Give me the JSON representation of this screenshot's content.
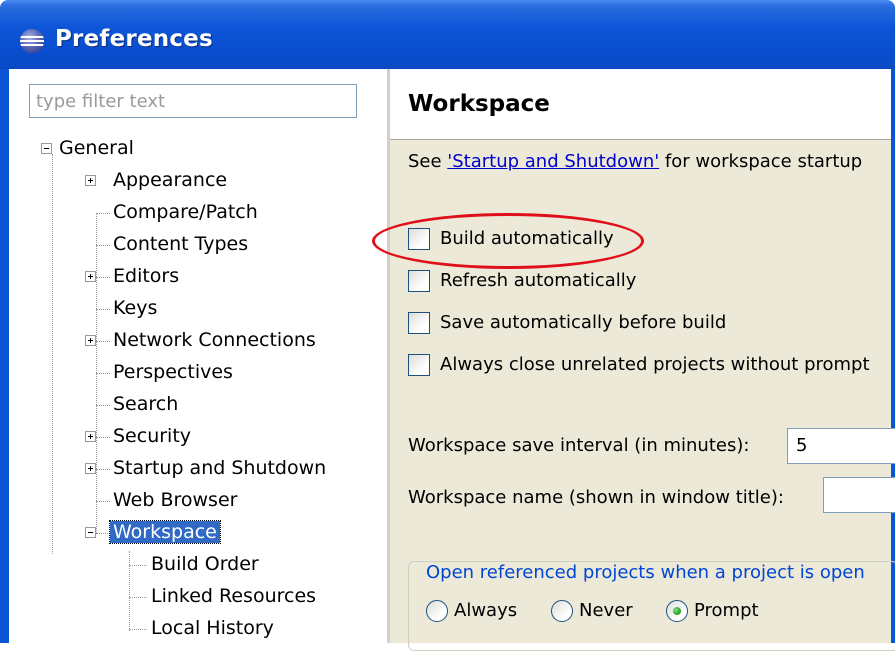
{
  "window": {
    "title": "Preferences",
    "icon": "eclipse-icon"
  },
  "filter": {
    "placeholder": "type filter text",
    "value": ""
  },
  "tree": {
    "items": [
      {
        "label": "General",
        "expanded": true
      },
      {
        "label": "Appearance",
        "expanded": false
      },
      {
        "label": "Compare/Patch"
      },
      {
        "label": "Content Types"
      },
      {
        "label": "Editors",
        "expanded": false
      },
      {
        "label": "Keys"
      },
      {
        "label": "Network Connections",
        "expanded": false
      },
      {
        "label": "Perspectives"
      },
      {
        "label": "Search"
      },
      {
        "label": "Security",
        "expanded": false
      },
      {
        "label": "Startup and Shutdown",
        "expanded": false
      },
      {
        "label": "Web Browser"
      },
      {
        "label": "Workspace",
        "expanded": true,
        "selected": true
      },
      {
        "label": "Build Order"
      },
      {
        "label": "Linked Resources"
      },
      {
        "label": "Local History"
      }
    ]
  },
  "page": {
    "title": "Workspace",
    "see_prefix": "See ",
    "see_link": "'Startup and Shutdown'",
    "see_suffix": " for workspace startup",
    "checkboxes": [
      {
        "label": "Build automatically",
        "checked": false,
        "highlighted": true
      },
      {
        "label": "Refresh automatically",
        "checked": false
      },
      {
        "label": "Save automatically before build",
        "checked": false
      },
      {
        "label": "Always close unrelated projects without prompt",
        "checked": false
      }
    ],
    "save_interval_label": "Workspace save interval (in minutes):",
    "save_interval_value": "5",
    "workspace_name_label": "Workspace name (shown in window title):",
    "workspace_name_value": "",
    "group_title": "Open referenced projects when a project is open",
    "radios": [
      {
        "label": "Always",
        "selected": false
      },
      {
        "label": "Never",
        "selected": false
      },
      {
        "label": "Prompt",
        "selected": true
      }
    ]
  },
  "colors": {
    "titlebar": "#0b54d6",
    "selection": "#316ac5",
    "link": "#0000cc",
    "highlight_ellipse": "#e0101a",
    "group_title": "#0046d5"
  }
}
